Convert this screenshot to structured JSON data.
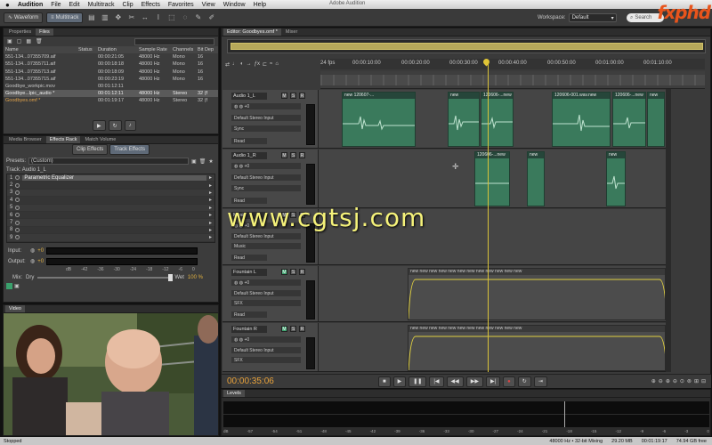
{
  "menubar": {
    "apple": "",
    "app": "Audition",
    "items": [
      "File",
      "Edit",
      "Multitrack",
      "Clip",
      "Effects",
      "Favorites",
      "View",
      "Window",
      "Help"
    ],
    "window_title": "Adobe Audition"
  },
  "toolbar": {
    "waveform": "Waveform",
    "multitrack": "Multitrack",
    "workspace_label": "Workspace:",
    "workspace_value": "Default",
    "search_placeholder": "Search"
  },
  "logo": {
    "a": "fx",
    "b": "phd"
  },
  "files_panel": {
    "tabs": [
      "Properties",
      "Files"
    ],
    "columns": [
      "Name",
      "Status",
      "Duration",
      "Sample Rate",
      "Channels",
      "Bit Dep"
    ],
    "rows": [
      [
        "551-134...07355709.aif",
        "",
        "00:00:21:05",
        "48000 Hz",
        "Mono",
        "16"
      ],
      [
        "551-134...07355711.aif",
        "",
        "00:00:18:18",
        "48000 Hz",
        "Mono",
        "16"
      ],
      [
        "551-134...07355713.aif",
        "",
        "00:00:18:09",
        "48000 Hz",
        "Mono",
        "16"
      ],
      [
        "551-134...07355715.aif",
        "",
        "00:00:23:19",
        "48000 Hz",
        "Mono",
        "16"
      ],
      [
        "Goodbye_workpic.mov",
        "",
        "00:01:12:11",
        "",
        "",
        ""
      ],
      [
        "Goodbye...lpic_audio *",
        "",
        "00:01:12:11",
        "48000 Hz",
        "Stereo",
        "32 (f"
      ],
      [
        "Goodbyes.omf *",
        "",
        "00:01:19:17",
        "48000 Hz",
        "Stereo",
        "32 (f"
      ]
    ]
  },
  "effects_panel": {
    "tabs": [
      "Media Browser",
      "Effects Rack",
      "Match Volume"
    ],
    "subtabs": [
      "Clip Effects",
      "Track Effects"
    ],
    "presets_label": "Presets:",
    "presets_value": "(Custom)",
    "track_label": "Track: Audio 1_L",
    "slots": [
      "Parametric Equalizer",
      "",
      "",
      "",
      "",
      "",
      "",
      "",
      ""
    ],
    "slot_numbers": [
      "1",
      "2",
      "3",
      "4",
      "5",
      "6",
      "7",
      "8",
      "9"
    ],
    "input_label": "Input:",
    "output_label": "Output:",
    "gain": "+0",
    "scale": [
      "dB",
      "-42",
      "-36",
      "-30",
      "-24",
      "-18",
      "-12",
      "-6",
      "0"
    ],
    "mix_label": "Mix:",
    "mix_dry": "Dry",
    "mix_wet": "Wet",
    "mix_value": "100 %"
  },
  "video_panel": {
    "tab": "Video"
  },
  "editor": {
    "tabs": [
      "Editor: Goodbyes.omf *",
      "Mixer"
    ],
    "fps": "24 fps",
    "ruler": [
      "00:00:10:00",
      "00:00:20:00",
      "00:00:30:00",
      "00:00:40:00",
      "00:00:50:00",
      "00:01:00:00",
      "00:01:10:00"
    ],
    "timecode": "00:00:35:06",
    "tracks": [
      {
        "name": "Audio 1_L",
        "input": "Default Stereo Input",
        "mode": "Sync",
        "read": "Read"
      },
      {
        "name": "Audio 1_R",
        "input": "Default Stereo Input",
        "mode": "Sync",
        "read": "Read"
      },
      {
        "name": "Music",
        "input": "Default Stereo Input",
        "mode": "Music",
        "read": "Read"
      },
      {
        "name": "Fountain L",
        "input": "Default Stereo Input",
        "mode": "SFX",
        "read": "Read"
      },
      {
        "name": "Fountain R",
        "input": "Default Stereo Input",
        "mode": "SFX",
        "read": "Read"
      }
    ],
    "clips_t1": [
      "new",
      "120607-...",
      "new",
      "120606-...new",
      "120606-001.wav.new",
      "120606-...new",
      "new"
    ],
    "clips_t2": [
      "120606-...new",
      "new",
      "new"
    ],
    "watermark": "www.cgtsj.com"
  },
  "levels_panel": {
    "tab": "Levels",
    "scale": [
      "dB",
      "-57",
      "-54",
      "-51",
      "-48",
      "-45",
      "-42",
      "-39",
      "-36",
      "-33",
      "-30",
      "-27",
      "-24",
      "-21",
      "-18",
      "-15",
      "-12",
      "-9",
      "-6",
      "-3",
      "0"
    ]
  },
  "statusbar": {
    "left": "Stopped",
    "sample": "48000 Hz • 32-bit Mixing",
    "memory": "29.20 MB",
    "duration": "00:01:19:17",
    "free": "74.94 GB free"
  },
  "colors": {
    "clip_green": "#3a7a5c",
    "playhead": "#d9c23a",
    "accent_orange": "#e8541c"
  }
}
